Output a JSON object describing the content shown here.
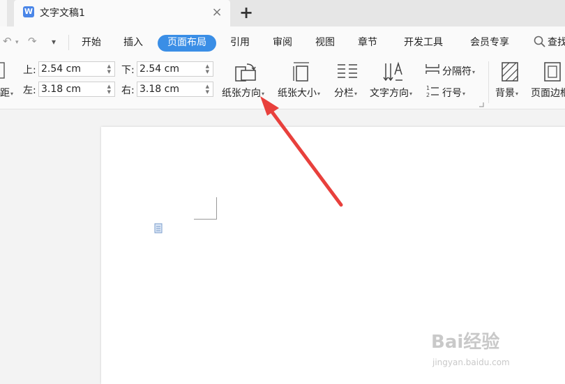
{
  "window": {
    "title": "文字文稿1",
    "app_logo": "W"
  },
  "tabs": {
    "close_icon": "×",
    "new_tab_icon": "+"
  },
  "quick_access": {
    "undo": "↶",
    "redo": "↷",
    "dropdown": "▾"
  },
  "menu": {
    "items": [
      "开始",
      "插入",
      "页面布局",
      "引用",
      "审阅",
      "视图",
      "章节",
      "开发工具",
      "会员专享"
    ],
    "active": "页面布局",
    "search_label": "查找"
  },
  "ribbon": {
    "margins_label_fragment": "距",
    "margin_top_label": "上:",
    "margin_top_value": "2.54 cm",
    "margin_bottom_label": "下:",
    "margin_bottom_value": "2.54 cm",
    "margin_left_label": "左:",
    "margin_left_value": "3.18 cm",
    "margin_right_label": "右:",
    "margin_right_value": "3.18 cm",
    "orientation_label": "纸张方向",
    "paper_size_label": "纸张大小",
    "columns_label": "分栏",
    "text_direction_label": "文字方向",
    "break_label": "分隔符",
    "line_number_label": "行号",
    "background_label": "背景",
    "page_border_label": "页面边框"
  },
  "watermark": {
    "text": "Bai经验",
    "sub": "jingyan.baidu.com"
  },
  "colors": {
    "accent": "#3a8ee6",
    "arrow": "#e8403c"
  }
}
